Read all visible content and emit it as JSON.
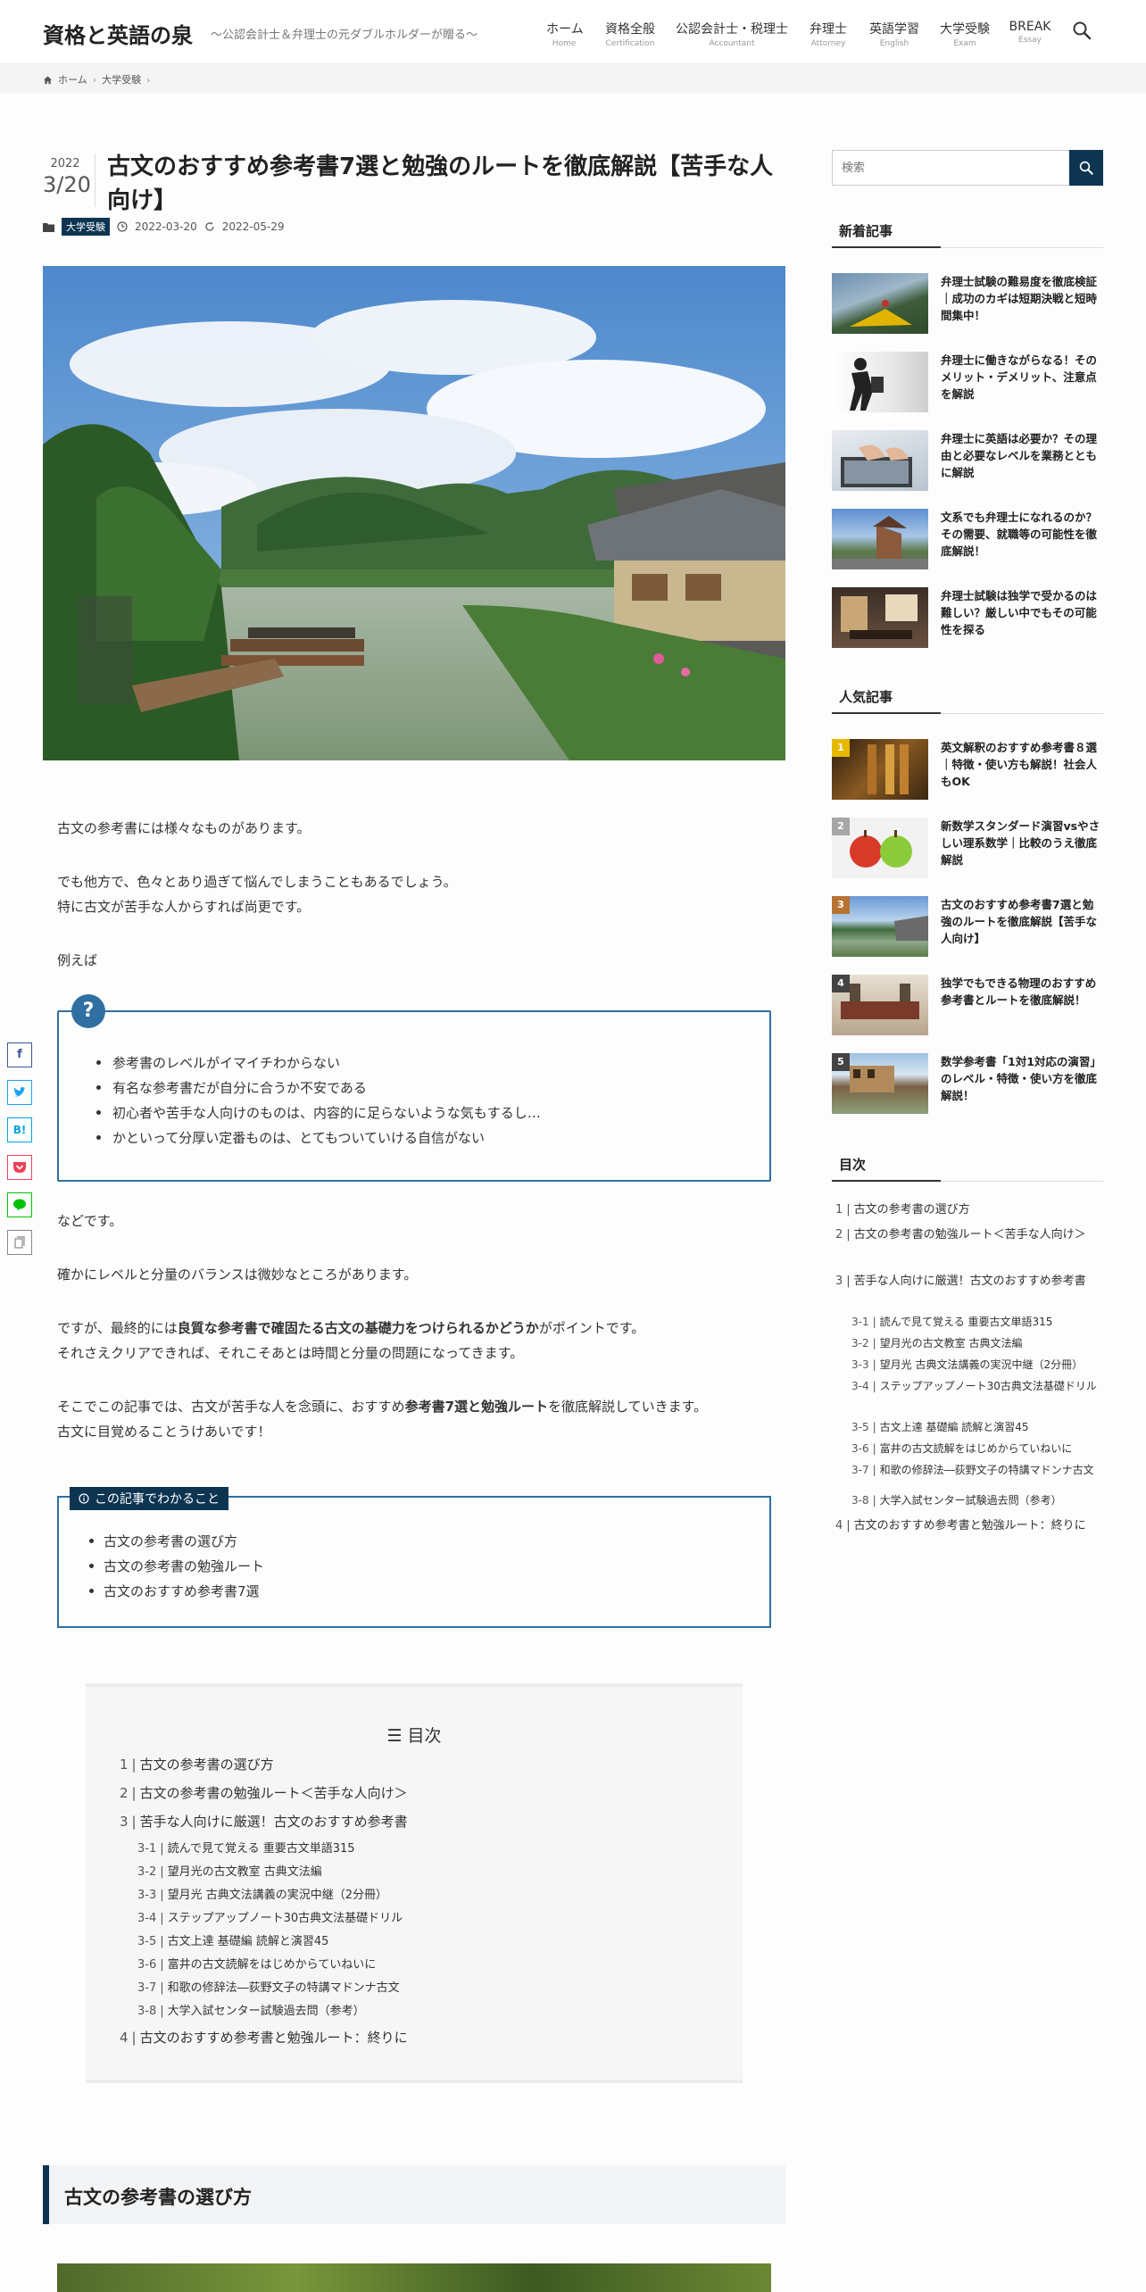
{
  "header": {
    "site_title": "資格と英語の泉",
    "tagline": "～公認会計士＆弁理士の元ダブルホルダーが贈る～",
    "nav": [
      {
        "label": "ホーム",
        "sub": "Home"
      },
      {
        "label": "資格全般",
        "sub": "Certification"
      },
      {
        "label": "公認会計士・税理士",
        "sub": "Accountant"
      },
      {
        "label": "弁理士",
        "sub": "Attorney"
      },
      {
        "label": "英語学習",
        "sub": "English"
      },
      {
        "label": "大学受験",
        "sub": "Exam"
      },
      {
        "label": "BREAK",
        "sub": "Essay"
      }
    ]
  },
  "breadcrumb": {
    "home": "ホーム",
    "category": "大学受験"
  },
  "post": {
    "year": "2022",
    "month_day": "3/20",
    "title": "古文のおすすめ参考書7選と勉強のルートを徹底解説【苦手な人向け】",
    "category": "大学受験",
    "published": "2022-03-20",
    "updated": "2022-05-29"
  },
  "body": {
    "p1": "古文の参考書には様々なものがあります。",
    "p2a": "でも他方で、色々とあり過ぎて悩んでしまうこともあるでしょう。",
    "p2b": "特に古文が苦手な人からすれば尚更です。",
    "p3": "例えば",
    "question_items": [
      "参考書のレベルがイマイチわからない",
      "有名な参考書だが自分に合うか不安である",
      "初心者や苦手な人向けのものは、内容的に足らないような気もするし…",
      "かといって分厚い定番ものは、とてもついていける自信がない"
    ],
    "p4": "などです。",
    "p5": "確かにレベルと分量のバランスは微妙なところがあります。",
    "p6_pre": "ですが、最終的には",
    "p6_bold": "良質な参考書で確固たる古文の基礎力をつけられるかどうか",
    "p6_post": "がポイントです。",
    "p7": "それさえクリアできれば、それこそあとは時間と分量の問題になってきます。",
    "p8_pre": "そこでこの記事では、古文が苦手な人を念頭に、おすすめ",
    "p8_bold": "参考書7選と勉強ルート",
    "p8_post": "を徹底解説していきます。",
    "p9": "古文に目覚めることうけあいです！",
    "learn_title": "この記事でわかること",
    "learn_items": [
      "古文の参考書の選び方",
      "古文の参考書の勉強ルート",
      "古文のおすすめ参考書7選"
    ],
    "h2": "古文の参考書の選び方"
  },
  "toc": {
    "title": "目次",
    "items": [
      {
        "num": "1",
        "label": "古文の参考書の選び方"
      },
      {
        "num": "2",
        "label": "古文の参考書の勉強ルート＜苦手な人向け＞"
      },
      {
        "num": "3",
        "label": "苦手な人向けに厳選！古文のおすすめ参考書"
      },
      {
        "num": "3-1",
        "label": "読んで見て覚える 重要古文単語315"
      },
      {
        "num": "3-2",
        "label": "望月光の古文教室 古典文法編"
      },
      {
        "num": "3-3",
        "label": "望月光 古典文法講義の実況中継（2分冊）"
      },
      {
        "num": "3-4",
        "label": "ステップアップノート30古典文法基礎ドリル"
      },
      {
        "num": "3-5",
        "label": "古文上達 基礎編 読解と演習45"
      },
      {
        "num": "3-6",
        "label": "富井の古文読解をはじめからていねいに"
      },
      {
        "num": "3-7",
        "label": "和歌の修辞法―荻野文子の特講マドンナ古文"
      },
      {
        "num": "3-8",
        "label": "大学入試センター試験過去問（参考）"
      },
      {
        "num": "4",
        "label": "古文のおすすめ参考書と勉強ルート：終りに"
      }
    ]
  },
  "share": [
    "f",
    "t",
    "B!",
    "p",
    "line",
    "copy"
  ],
  "sidebar": {
    "search_placeholder": "検索",
    "new_title": "新着記事",
    "new_posts": [
      "弁理士試験の難易度を徹底検証｜成功のカギは短期決戦と短時間集中！",
      "弁理士に働きながらなる！そのメリット・デメリット、注意点を解説",
      "弁理士に英語は必要か？その理由と必要なレベルを業務とともに解説",
      "文系でも弁理士になれるのか？その需要、就職等の可能性を徹底解説！",
      "弁理士試験は独学で受かるのは難しい？厳しい中でもその可能性を探る"
    ],
    "popular_title": "人気記事",
    "popular_posts": [
      {
        "rank": "1",
        "title": "英文解釈のおすすめ参考書８選｜特徴・使い方も解説！社会人もOK"
      },
      {
        "rank": "2",
        "title": "新数学スタンダード演習vsやさしい理系数学｜比較のうえ徹底解説"
      },
      {
        "rank": "3",
        "title": "古文のおすすめ参考書7選と勉強のルートを徹底解説【苦手な人向け】"
      },
      {
        "rank": "4",
        "title": "独学でもできる物理のおすすめ参考書とルートを徹底解説！"
      },
      {
        "rank": "5",
        "title": "数学参考書「1対1対応の演習」のレベル・特徴・使い方を徹底解説！"
      }
    ],
    "toc_title": "目次",
    "toc_items": [
      {
        "num": "1",
        "label": "古文の参考書の選び方"
      },
      {
        "num": "2",
        "label": "古文の参考書の勉強ルート＜苦手な人向け＞"
      },
      {
        "num": "3",
        "label": "苦手な人向けに厳選！古文のおすすめ参考書"
      },
      {
        "num": "3-1",
        "label": "読んで見て覚える 重要古文単語315"
      },
      {
        "num": "3-2",
        "label": "望月光の古文教室 古典文法編"
      },
      {
        "num": "3-3",
        "label": "望月光 古典文法講義の実況中継（2分冊）"
      },
      {
        "num": "3-4",
        "label": "ステップアップノート30古典文法基礎ドリル"
      },
      {
        "num": "3-5",
        "label": "古文上達 基礎編 読解と演習45"
      },
      {
        "num": "3-6",
        "label": "富井の古文読解をはじめからていねいに"
      },
      {
        "num": "3-7",
        "label": "和歌の修辞法―荻野文子の特講マドンナ古文"
      },
      {
        "num": "3-8",
        "label": "大学入試センター試験過去問（参考）"
      },
      {
        "num": "4",
        "label": "古文のおすすめ参考書と勉強ルート：終りに"
      }
    ]
  }
}
